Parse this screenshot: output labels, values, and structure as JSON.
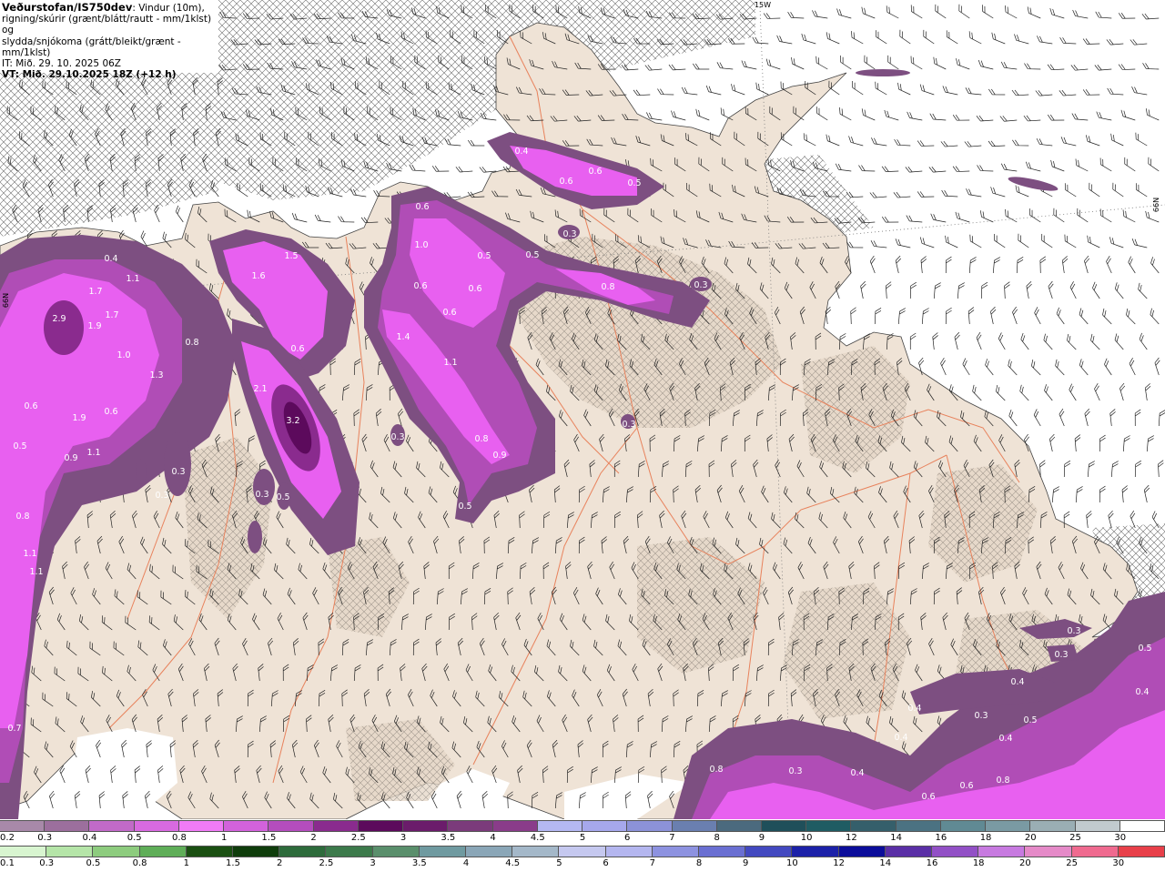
{
  "header": {
    "source": "Veðurstofan/IS750dev",
    "line1_suffix": ": Vindur (10m),",
    "line2": "rigning/skúrir (grænt/blátt/rautt - mm/1klst) og",
    "line3": "slydda/snjókoma (grátt/bleikt/grænt - mm/1klst)",
    "it": "IT: Mið. 29. 10. 2025 06Z",
    "vt": "VT: Mið. 29.10.2025 18Z (+12 h)"
  },
  "grid_labels": {
    "lon_top": "15W",
    "lat_left": "66N",
    "lat_right": "66N"
  },
  "colors": {
    "sea": "#ffffff",
    "land": "#efe3d6",
    "roads": "#e8825c",
    "precip_low": "#7d4f81",
    "precip_mid": "#b04db6",
    "precip_high": "#e860f0",
    "precip_peak": "#5c0a5c"
  },
  "precip_values": [
    {
      "v": "0.4"
    },
    {
      "v": "0.6"
    },
    {
      "v": "0.6"
    },
    {
      "v": "0.5"
    },
    {
      "v": "0.3"
    },
    {
      "v": "0.6"
    },
    {
      "v": "1.0"
    },
    {
      "v": "0.5"
    },
    {
      "v": "0.5"
    },
    {
      "v": "0.6"
    },
    {
      "v": "0.6"
    },
    {
      "v": "0.6"
    },
    {
      "v": "0.8"
    },
    {
      "v": "0.3"
    },
    {
      "v": "1.4"
    },
    {
      "v": "1.1"
    },
    {
      "v": "0.8"
    },
    {
      "v": "0.9"
    },
    {
      "v": "0.5"
    },
    {
      "v": "0.4"
    },
    {
      "v": "1.1"
    },
    {
      "v": "1.7"
    },
    {
      "v": "1.7"
    },
    {
      "v": "2.9"
    },
    {
      "v": "1.9"
    },
    {
      "v": "1.0"
    },
    {
      "v": "0.8"
    },
    {
      "v": "1.3"
    },
    {
      "v": "1.6"
    },
    {
      "v": "1.5"
    },
    {
      "v": "0.6"
    },
    {
      "v": "2.1"
    },
    {
      "v": "3.2"
    },
    {
      "v": "0.6"
    },
    {
      "v": "1.9"
    },
    {
      "v": "0.6"
    },
    {
      "v": "0.5"
    },
    {
      "v": "0.9"
    },
    {
      "v": "1.1"
    },
    {
      "v": "0.3"
    },
    {
      "v": "0.3"
    },
    {
      "v": "0.3"
    },
    {
      "v": "0.5"
    },
    {
      "v": "0.8"
    },
    {
      "v": "1.1"
    },
    {
      "v": "1.1"
    },
    {
      "v": "0.7"
    },
    {
      "v": "0.3"
    },
    {
      "v": "0.3"
    },
    {
      "v": "0.5"
    },
    {
      "v": "0.4"
    },
    {
      "v": "0.4"
    },
    {
      "v": "0.3"
    },
    {
      "v": "0.4"
    },
    {
      "v": "0.5"
    },
    {
      "v": "0.4"
    },
    {
      "v": "0.4"
    },
    {
      "v": "0.3"
    },
    {
      "v": "0.4"
    },
    {
      "v": "0.6"
    },
    {
      "v": "0.8"
    },
    {
      "v": "0.6"
    },
    {
      "v": "0.8"
    },
    {
      "v": "0.3"
    },
    {
      "v": "0.3"
    }
  ],
  "scale_snow": {
    "labels": [
      "0.2",
      "0.3",
      "0.4",
      "0.5",
      "0.8",
      "1",
      "1.5",
      "2",
      "2.5",
      "3",
      "3.5",
      "4",
      "4.5",
      "5",
      "6",
      "7",
      "8",
      "9",
      "10",
      "12",
      "14",
      "16",
      "18",
      "20",
      "25",
      "30"
    ],
    "colors": [
      "#a889a9",
      "#9c6f9d",
      "#c16ac8",
      "#d86ae0",
      "#f07bf6",
      "#d262db",
      "#b44dbd",
      "#8a2b8e",
      "#5c0a5c",
      "#6b1c6b",
      "#7b3b7b",
      "#8a3c8a",
      "#b4b8f2",
      "#a6a8ec",
      "#8c92d8",
      "#6a7fb0",
      "#4b6a7e",
      "#1f4f5a",
      "#1f5c63",
      "#355f6b",
      "#4b7282",
      "#608a94",
      "#7a9aa3",
      "#9aaeb4",
      "#c1cace",
      "#ffffff"
    ]
  },
  "scale_rain": {
    "labels": [
      "0.1",
      "0.3",
      "0.5",
      "0.8",
      "1",
      "1.5",
      "2",
      "2.5",
      "3",
      "3.5",
      "4",
      "4.5",
      "5",
      "6",
      "7",
      "8",
      "9",
      "10",
      "12",
      "14",
      "16",
      "18",
      "20",
      "25",
      "30"
    ],
    "colors": [
      "#d8f5d0",
      "#b5e5a8",
      "#8dcc7e",
      "#5fae58",
      "#1a4f12",
      "#0f3d0c",
      "#2d6b3b",
      "#3c7a4b",
      "#5a8f6c",
      "#6f9aa0",
      "#8aa6b7",
      "#a4b8c9",
      "#c5c8ef",
      "#b4b6ef",
      "#8d92e0",
      "#6a6fd2",
      "#4349c0",
      "#1c21a8",
      "#0b0d9a",
      "#5a2fa6",
      "#9250c6",
      "#c77ae0",
      "#e58ac8",
      "#ef6a8f",
      "#e8404a",
      "#d8101e"
    ]
  }
}
